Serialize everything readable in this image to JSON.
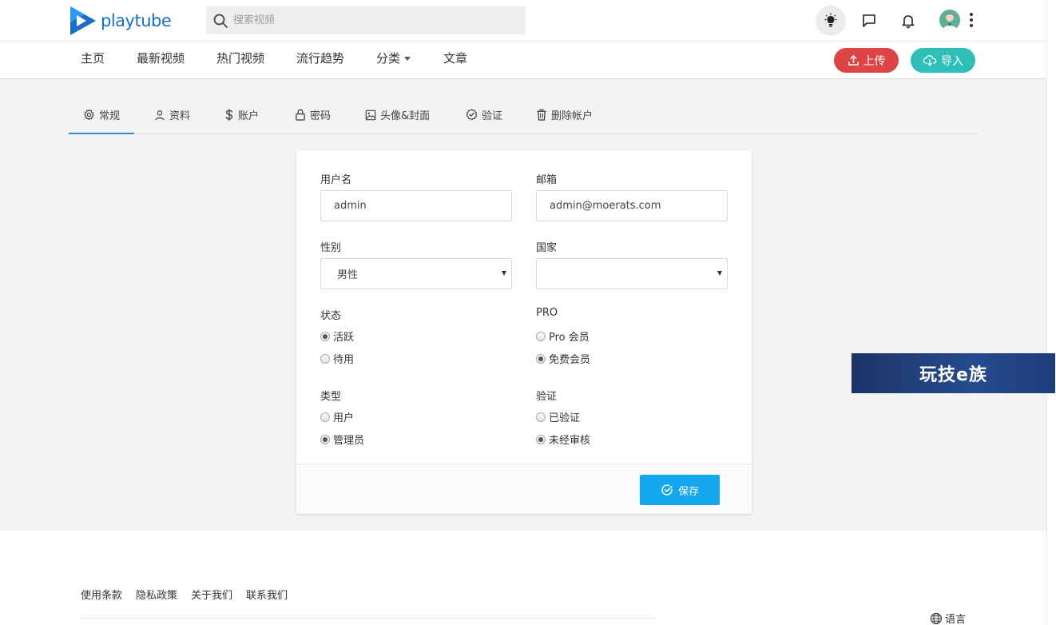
{
  "brand": {
    "name": "playtube"
  },
  "search": {
    "placeholder": "搜索视频"
  },
  "nav": {
    "items": [
      "主页",
      "最新视频",
      "热门视频",
      "流行趋势",
      "分类",
      "文章"
    ],
    "upload_label": "上传",
    "import_label": "导入"
  },
  "tabs": [
    "常规",
    "资料",
    "账户",
    "密码",
    "头像&封面",
    "验证",
    "删除帐户"
  ],
  "form": {
    "username_label": "用户名",
    "username_value": "admin",
    "email_label": "邮箱",
    "email_value": "admin@moerats.com",
    "gender_label": "性别",
    "gender_value": "男性",
    "country_label": "国家",
    "country_value": "",
    "status_label": "状态",
    "status_options": [
      "活跃",
      "待用"
    ],
    "pro_label": "PRO",
    "pro_options": [
      "Pro 会员",
      "免费会员"
    ],
    "type_label": "类型",
    "type_options": [
      "用户",
      "管理员"
    ],
    "verify_label": "验证",
    "verify_options": [
      "已验证",
      "未经审核"
    ],
    "save_label": "保存"
  },
  "watermark": "玩技e族",
  "footer": {
    "links": [
      "使用条款",
      "隐私政策",
      "关于我们",
      "联系我们"
    ],
    "language_label": "语言"
  },
  "colors": {
    "brand_blue": "#1a6fc4",
    "upload_red": "#dc4446",
    "import_teal": "#2ec0b8",
    "save_blue": "#12a7ee",
    "tab_active": "#2b8fd6"
  }
}
